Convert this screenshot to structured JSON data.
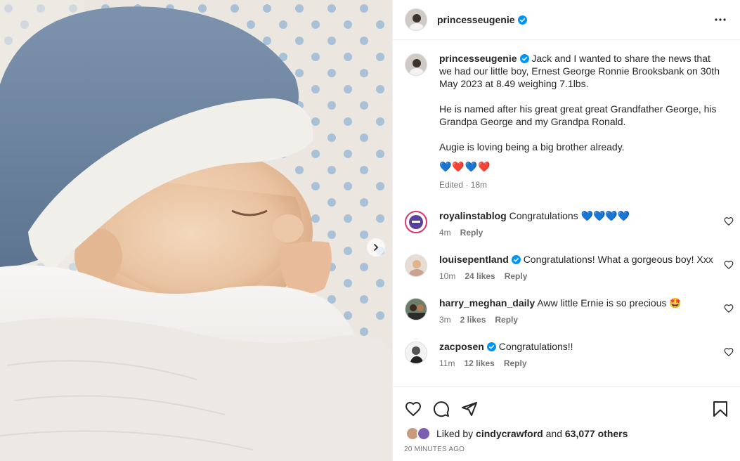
{
  "post": {
    "author": "princesseugenie",
    "more_label": "More options"
  },
  "caption": {
    "username": "princesseugenie",
    "paragraphs": [
      "Jack and I wanted to share the news that we had our little boy, Ernest George Ronnie Brooksbank on 30th May 2023 at 8.49 weighing 7.1lbs.",
      "He is named after his great great great Grandfather George, his Grandpa George and my Grandpa Ronald.",
      "Augie is loving being a big brother already."
    ],
    "emoji": "💙❤️💙❤️",
    "edited": "Edited · 18m"
  },
  "comments": [
    {
      "username": "royalinstablog",
      "verified": false,
      "text": "Congratulations 💙💙💙💙",
      "time": "4m",
      "likes": "",
      "reply": "Reply"
    },
    {
      "username": "louisepentland",
      "verified": true,
      "text": "Congratulations! What a gorgeous boy! Xxx",
      "time": "10m",
      "likes": "24 likes",
      "reply": "Reply"
    },
    {
      "username": "harry_meghan_daily",
      "verified": false,
      "text": "Aww little Ernie is so precious 🤩",
      "time": "3m",
      "likes": "2 likes",
      "reply": "Reply"
    },
    {
      "username": "zacposen",
      "verified": true,
      "text": "Congratulations!!",
      "time": "11m",
      "likes": "12 likes",
      "reply": "Reply"
    }
  ],
  "likes": {
    "prefix": "Liked by",
    "user": "cindycrawford",
    "and": "and",
    "others": "63,077 others"
  },
  "timestamp": "20 MINUTES AGO",
  "colors": {
    "verified": "#0095f6",
    "muted": "#737373",
    "border": "#efefef",
    "text": "#262626"
  }
}
